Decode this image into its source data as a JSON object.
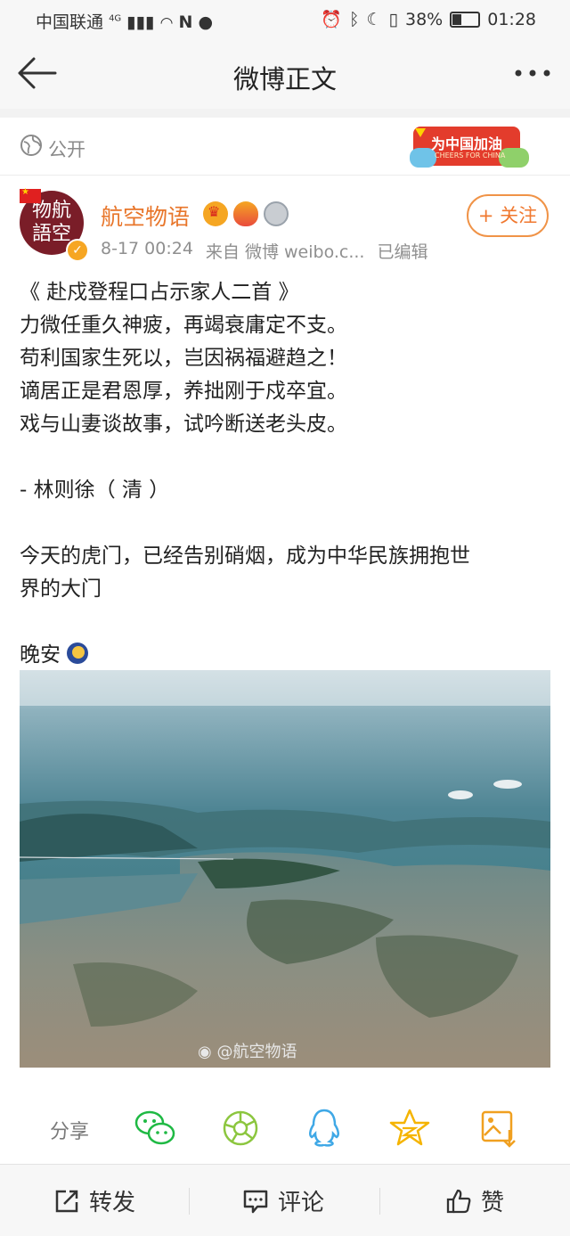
{
  "status_bar": {
    "carrier": "中国联通",
    "network": "4G",
    "battery": "38%",
    "time": "01:28"
  },
  "header": {
    "title": "微博正文"
  },
  "visibility": {
    "label": "公开",
    "promo_text": "为中国加油",
    "promo_sub": "CHEERS FOR CHINA"
  },
  "author": {
    "name": "航空物语",
    "avatar_text_1": "物航",
    "avatar_text_2": "語空",
    "date": "8-17 00:24",
    "source": "来自 微博 weibo.c...",
    "edited": "已编辑",
    "follow_label": "+ 关注",
    "accent_color": "#e8762b"
  },
  "post": {
    "lines": [
      "《 赴戍登程口占示家人二首 》",
      "力微任重久神疲，再竭衰庸定不支。",
      "苟利国家生死以，岂因祸福避趋之！",
      "谪居正是君恩厚，养拙刚于戍卒宜。",
      "戏与山妻谈故事，试吟断送老头皮。",
      "",
      "- 林则徐（ 清 ）",
      "",
      "今天的虎门，已经告别硝烟，成为中华民族拥抱世",
      "界的大门",
      "",
      "晚安"
    ],
    "watermark": "@航空物语"
  },
  "share": {
    "label": "分享",
    "icons": [
      "wechat-icon",
      "moments-icon",
      "qq-icon",
      "qzone-icon",
      "save-image-icon"
    ]
  },
  "bottom_bar": {
    "repost": "转发",
    "comment": "评论",
    "like": "赞"
  }
}
